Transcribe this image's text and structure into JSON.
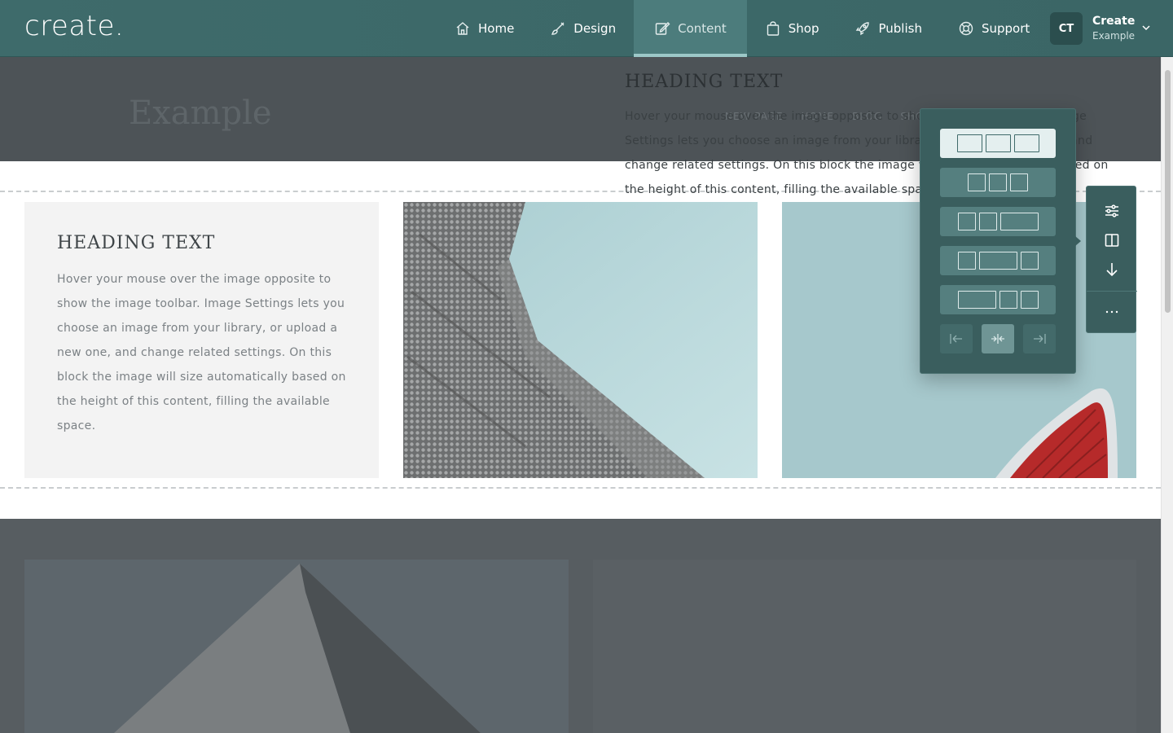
{
  "app": {
    "logo": "create.",
    "nav": [
      {
        "label": "Home",
        "icon": "home-icon"
      },
      {
        "label": "Design",
        "icon": "brush-icon"
      },
      {
        "label": "Content",
        "icon": "edit-icon",
        "active": true
      },
      {
        "label": "Shop",
        "icon": "bag-icon"
      },
      {
        "label": "Publish",
        "icon": "rocket-icon"
      },
      {
        "label": "Support",
        "icon": "lifebuoy-icon"
      }
    ],
    "account": {
      "initials": "CT",
      "name": "Create",
      "site": "Example"
    },
    "colors": {
      "topbar": "#3e6b6b",
      "accent": "#9cc8c8",
      "panel": "#3a5e5e"
    }
  },
  "site": {
    "title": "Example",
    "nav": [
      "NEW PAGE",
      "HOME",
      "BLOG",
      "SHO"
    ]
  },
  "block": {
    "heading": "HEADING TEXT",
    "body": "Hover your mouse over the image opposite to show the image toolbar. Image Settings lets you choose an image from your library, or upload a new one, and change related settings. On this block the image will size automatically based on the height of this content, filling the available space."
  },
  "lower_block": {
    "heading": "HEADING TEXT",
    "body": "Hover your mouse over the image opposite to show the image toolbar. Image Settings lets you choose an image from your library, or upload a new one, and change related settings. On this block the image will size automatically based on the height of this content, filling the available space."
  },
  "layout_popover": {
    "selected_index": 0,
    "options": [
      "equal-three",
      "equal-three-narrow",
      "small-small-wide",
      "small-wide-small",
      "wide-small-small"
    ],
    "align_buttons": [
      "align-left-icon",
      "align-center-icon",
      "align-right-icon"
    ]
  },
  "toolbar": {
    "tools": [
      "settings-sliders-icon",
      "columns-layout-icon",
      "arrow-down-icon",
      "more-icon"
    ]
  }
}
